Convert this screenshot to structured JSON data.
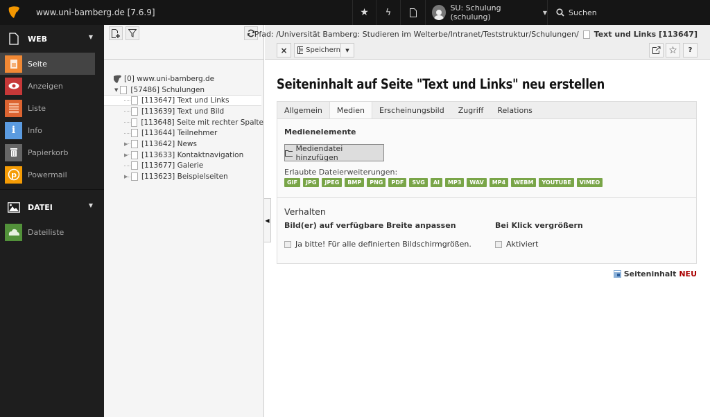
{
  "topbar": {
    "site_title": "www.uni-bamberg.de [7.6.9]",
    "user_label": "SU: Schulung (schulung)",
    "search_label": "Suchen"
  },
  "modules": {
    "groups": [
      {
        "label": "WEB",
        "items": [
          {
            "label": "Seite",
            "color": "#f18935",
            "active": true
          },
          {
            "label": "Anzeigen",
            "color": "#c63838"
          },
          {
            "label": "Liste",
            "color": "#dc6431"
          },
          {
            "label": "Info",
            "color": "#5b9be0"
          },
          {
            "label": "Papierkorb",
            "color": "#666666"
          },
          {
            "label": "Powermail",
            "color": "#f59c05"
          }
        ]
      },
      {
        "label": "DATEI",
        "items": [
          {
            "label": "Dateiliste",
            "color": "#52913a"
          }
        ]
      }
    ]
  },
  "tree": {
    "root": "[0] www.uni-bamberg.de",
    "parent": "[57486] Schulungen",
    "children": [
      {
        "label": "[113647] Text und Links",
        "selected": true
      },
      {
        "label": "[113639] Text und Bild"
      },
      {
        "label": "[113648] Seite mit rechter Spalte"
      },
      {
        "label": "[113644] Teilnehmer"
      },
      {
        "label": "[113642] News",
        "expandable": true
      },
      {
        "label": "[113633] Kontaktnavigation",
        "expandable": true
      },
      {
        "label": "[113677] Galerie"
      },
      {
        "label": "[113623] Beispielseiten",
        "expandable": true
      }
    ]
  },
  "docheader": {
    "path_prefix": "Pfad: /Universität Bamberg: Studieren im Welterbe/Intranet/Teststruktur/Schulungen/",
    "path_current": "Text und Links [113647]",
    "close_label": "×",
    "save_label": "Speichern",
    "help_label": "?"
  },
  "content": {
    "title": "Seiteninhalt auf Seite \"Text und Links\" neu erstellen",
    "tabs": [
      "Allgemein",
      "Medien",
      "Erscheinungsbild",
      "Zugriff",
      "Relations"
    ],
    "active_tab": "Medien",
    "media_label": "Medienelemente",
    "add_media_label": "Mediendatei hinzufügen",
    "allowed_label": "Erlaubte Dateierweiterungen:",
    "extensions": [
      "GIF",
      "JPG",
      "JPEG",
      "BMP",
      "PNG",
      "PDF",
      "SVG",
      "AI",
      "MP3",
      "WAV",
      "MP4",
      "WEBM",
      "YOUTUBE",
      "VIMEO"
    ],
    "behaviour_label": "Verhalten",
    "field1_label": "Bild(er) auf verfügbare Breite anpassen",
    "field1_checkbox": "Ja bitte! Für alle definierten Bildschirmgrößen.",
    "field1_checked": false,
    "field2_label": "Bei Klick vergrößern",
    "field2_checkbox": "Aktiviert",
    "field2_checked": false,
    "footer_record": "Seiteninhalt",
    "footer_status": "NEU"
  }
}
